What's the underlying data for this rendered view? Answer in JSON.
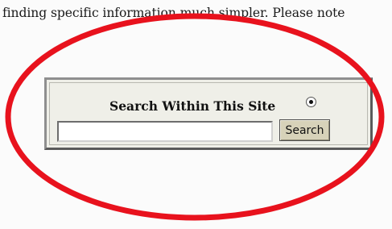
{
  "page": {
    "intro_text": "finding specific information much simpler. Please note"
  },
  "search": {
    "title": "Search Within This Site",
    "input_value": "",
    "button_label": "Search",
    "radio_selected": true
  },
  "annotation": {
    "color": "#e8121d"
  }
}
